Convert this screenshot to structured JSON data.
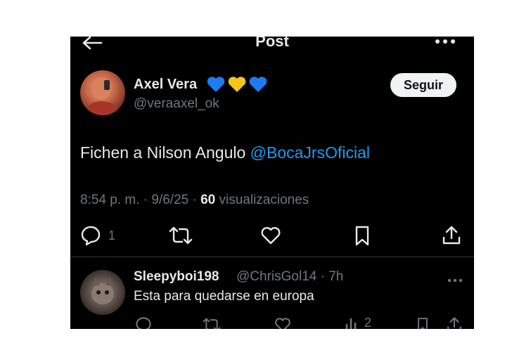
{
  "header": {
    "title": "Post"
  },
  "author": {
    "name": "Axel Vera",
    "emoji": "💙💛💙",
    "handle": "@veraaxel_ok"
  },
  "follow_label": "Seguir",
  "tweet": {
    "text": "Fichen a Nilson Angulo ",
    "mention": "@BocaJrsOficial"
  },
  "meta": {
    "time": "8:54 p. m. · 9/6/25 · ",
    "views_count": "60",
    "views_label": " visualizaciones"
  },
  "actions": {
    "reply_count": "1"
  },
  "reply": {
    "name": "Sleepyboi198",
    "handle_time": "@ChrisGol14 · 7h",
    "text": "Esta para quedarse en europa",
    "views_count": "2"
  },
  "colors": {
    "accent": "#1d9bf0",
    "background": "#000000",
    "muted": "#71767b"
  },
  "icons": [
    "back-arrow-icon",
    "more-icon",
    "reply-icon",
    "repost-icon",
    "like-icon",
    "bookmark-icon",
    "share-icon",
    "views-icon"
  ]
}
